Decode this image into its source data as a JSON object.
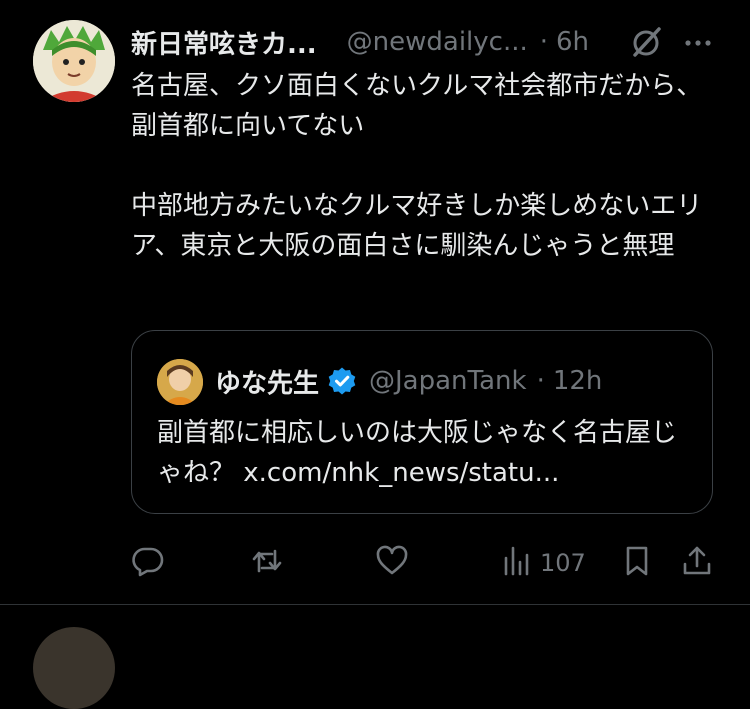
{
  "tweet": {
    "display_name": "新日常呟きカ...",
    "handle": "@newdailyc...",
    "separator": "·",
    "time": "6h",
    "text": "名古屋、クソ面白くないクルマ社会都市だから、副首都に向いてない\n\n中部地方みたいなクルマ好きしか楽しめないエリア、東京と大阪の面白さに馴染んじゃうと無理"
  },
  "quote": {
    "display_name": "ゆな先生",
    "handle": "@JapanTank",
    "separator": "·",
    "time": "12h",
    "text": "副首都に相応しいのは大阪じゃなく名古屋じゃね？ x.com/nhk_news/statu..."
  },
  "actions": {
    "views_count": "107"
  },
  "icons": [
    "grok-icon",
    "more-icon",
    "verified-icon",
    "reply-icon",
    "repost-icon",
    "like-icon",
    "views-icon",
    "bookmark-icon",
    "share-icon"
  ],
  "colors": {
    "background": "#000000",
    "text": "#e7e9ea",
    "secondary": "#71767b",
    "verified": "#1d9bf0",
    "border": "#3b4045"
  }
}
